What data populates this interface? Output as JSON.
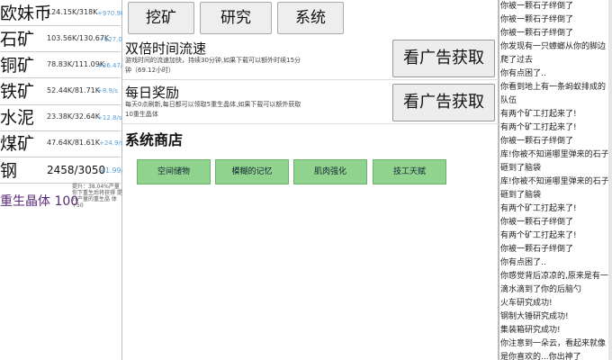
{
  "resources": [
    {
      "name": "欧妹币",
      "amount": "124.15K/318K",
      "rate": "+970.9K/s"
    },
    {
      "name": "石矿",
      "amount": "103.56K/130.67K",
      "rate": "+127.07/s"
    },
    {
      "name": "铜矿",
      "amount": "78.83K/111.09K",
      "rate": "+36.47/s"
    },
    {
      "name": "铁矿",
      "amount": "52.44K/81.71K",
      "rate": "+8.9/s"
    },
    {
      "name": "水泥",
      "amount": "23.38K/32.64K",
      "rate": "+12.8/s"
    },
    {
      "name": "煤矿",
      "amount": "47.64K/81.61K",
      "rate": "+24.9/s"
    },
    {
      "name": "钢",
      "amount": "2458/3050",
      "rate": "+1.99/s"
    }
  ],
  "crystal": {
    "label": "重生晶体 100",
    "sub": "提升：38.04%产量 你下重生后将获得 提升产量的重生晶 体+50"
  },
  "tabs": [
    "挖矿",
    "研究",
    "系统"
  ],
  "cards": [
    {
      "title": "双倍时间流速",
      "desc": "游戏时间的流速加快，持续30分钟,如果下载可以额外时续15分钟（69.12小时）",
      "button": "看广告获取"
    },
    {
      "title": "每日奖励",
      "desc": "每天0点刷新,每日都可以领取5重生晶体,如果下载可以额外获取10重生晶体",
      "button": "看广告获取"
    }
  ],
  "shop": {
    "title": "系统商店",
    "items": [
      "空间储物",
      "模糊的记忆",
      "肌肉强化",
      "技工天赋"
    ]
  },
  "log": [
    "你被一颗石子绊倒了",
    "你被一颗石子绊倒了",
    "你被一颗石子绊倒了",
    "你发现有一只蟑螂从你的脚边",
    "爬了过去",
    "你有点困了..",
    "你看到地上有一条蚂蚁排成的",
    "队伍",
    "有两个矿工打起来了!",
    "有两个矿工打起来了!",
    "你被一颗石子绊倒了",
    "库!你被不知道哪里弹来的石子",
    "砸到了脑袋",
    "库!你被不知道哪里弹来的石子",
    "砸到了脑袋",
    "有两个矿工打起来了!",
    "你被一颗石子绊倒了",
    "有两个矿工打起来了!",
    "你被一颗石子绊倒了",
    "你有点困了..",
    "你感觉背后凉凉的,原来是有一",
    "滴水滴到了你的后脑勺",
    "火车研究成功!",
    "钢制大锤研究成功!",
    "集装箱研究成功!",
    "你注意到一朵云，看起来就像",
    "是你喜欢的...你出神了"
  ]
}
